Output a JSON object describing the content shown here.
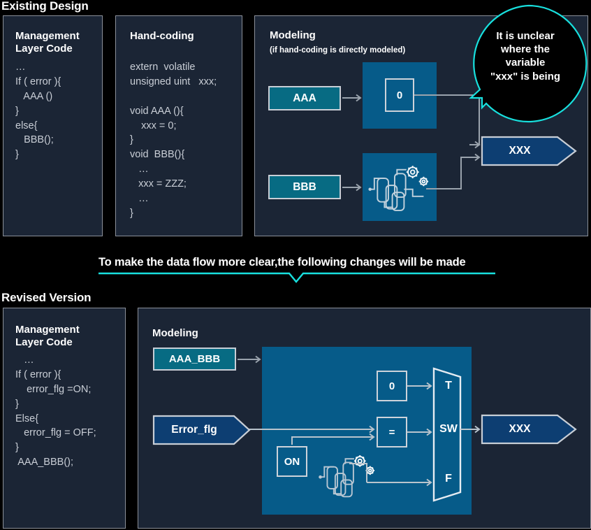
{
  "sections": {
    "existing": {
      "title": "Existing Design"
    },
    "revised": {
      "title": "Revised Version"
    }
  },
  "banner": {
    "text": "To make the data flow more clear,the following changes will be made",
    "accent_color": "#18e0de"
  },
  "existing": {
    "management_panel": {
      "title": "Management\nLayer Code",
      "code": "…\nIf ( error ){\n   AAA ()\n}\nelse{\n   BBB();\n}"
    },
    "handcoding_panel": {
      "title": "Hand-coding",
      "code": "extern  volatile\nunsigned uint   xxx;\n\nvoid AAA (){\n    xxx = 0;\n}\nvoid  BBB(){\n   …\n   xxx = ZZZ;\n   …\n}"
    },
    "modeling_panel": {
      "title": "Modeling",
      "subtitle": "(if hand-coding is directly modeled)",
      "port_aaa": "AAA",
      "port_bbb": "BBB",
      "const_block": "0",
      "subsystem_icon": "model-subsystem-icon",
      "output_port": "XXX"
    },
    "callout": {
      "text": "It is unclear\nwhere the\nvariable\n\"xxx\" is being",
      "border_color": "#18e0de"
    }
  },
  "revised": {
    "management_panel": {
      "title": "Management\nLayer Code",
      "code": "   …\nIf ( error ){\n    error_flg =ON;\n}\nElse{\n   error_flg = OFF;\n}\n AAA_BBB();"
    },
    "modeling_panel": {
      "title": "Modeling",
      "port_aaa_bbb": "AAA_BBB",
      "port_error_flg": "Error_flg",
      "const_block": "0",
      "compare_block": "=",
      "on_block": "ON",
      "subsystem_icon": "model-subsystem-icon",
      "switch_block": {
        "top": "T",
        "middle": "SW",
        "bottom": "F"
      },
      "output_port": "XXX"
    }
  },
  "colors": {
    "background": "#000000",
    "panel_fill": "#1b2535",
    "panel_border": "#8b9099",
    "canvas_blue": "#065b89",
    "teal": "#076b83",
    "navy": "#0d3e72",
    "wire": "#9aa3ad",
    "accent_cyan": "#18e0de"
  }
}
